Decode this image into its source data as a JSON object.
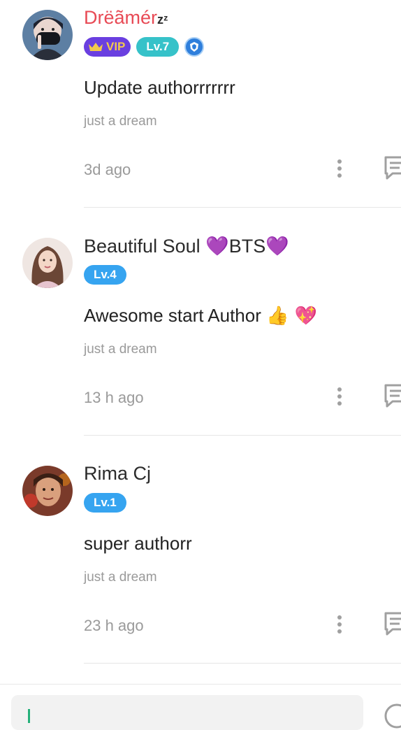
{
  "comments": [
    {
      "username": "Drëãmér",
      "name_suffix": "zᶻ",
      "vip_label": "VIP",
      "level": "Lv.7",
      "text": "Update authorrrrrrr",
      "chapter": "just a dream",
      "time": "3d ago"
    },
    {
      "username": "Beautiful Soul",
      "name_emoji_1": "💜",
      "name_mid": "BTS",
      "name_emoji_2": "💜",
      "level": "Lv.4",
      "text": "Awesome start Author",
      "text_emoji": "👍 💖",
      "chapter": "just a dream",
      "time": "13 h ago"
    },
    {
      "username": "Rima Cj",
      "level": "Lv.1",
      "text": "super authorr",
      "chapter": "just a dream",
      "time": "23 h ago"
    }
  ],
  "colors": {
    "vip_name": "#e84a55",
    "vip_badge": "#6a3fe0",
    "level_teal": "#36c2c9",
    "level_blue": "#36a4f0",
    "meta_gray": "#9a9a9a"
  },
  "icons": [
    "crown-icon",
    "shield-badge-icon",
    "more-vertical-icon",
    "reply-comment-icon",
    "send-icon"
  ]
}
